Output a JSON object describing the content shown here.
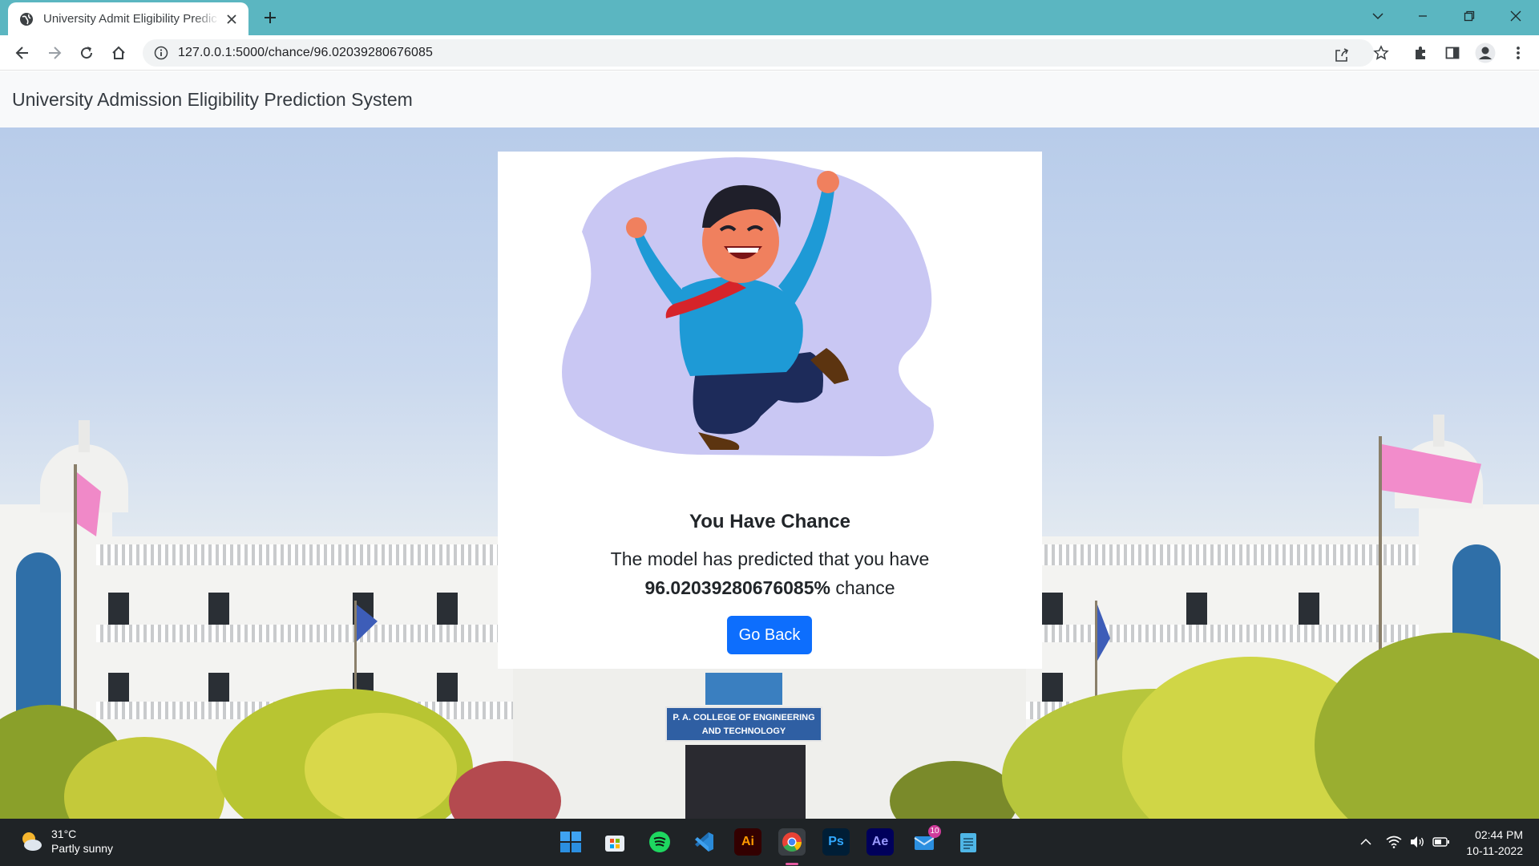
{
  "browser": {
    "tab_title": "University Admit Eligibility Predic",
    "url": "127.0.0.1:5000/chance/96.02039280676085"
  },
  "navbar": {
    "brand": "University Admission Eligibility Prediction System"
  },
  "result": {
    "heading": "You Have Chance",
    "line1": "The model has predicted that you have",
    "percent": "96.02039280676085%",
    "suffix": "chance",
    "button_label": "Go Back"
  },
  "background": {
    "college_sign_line1": "P. A. COLLEGE OF ENGINEERING",
    "college_sign_line2": "AND TECHNOLOGY"
  },
  "taskbar": {
    "temperature": "31°C",
    "condition": "Partly sunny",
    "mail_badge": "10",
    "time": "02:44 PM",
    "date": "10-11-2022",
    "apps": [
      "windows-start",
      "microsoft-store",
      "spotify",
      "vscode",
      "illustrator",
      "chrome",
      "photoshop",
      "after-effects",
      "mail",
      "notepad"
    ]
  },
  "colors": {
    "tab_strip": "#5bb6c1",
    "primary_button": "#0d6efd",
    "navbar_bg": "#f8f9fa",
    "taskbar_bg": "#1f2326"
  }
}
